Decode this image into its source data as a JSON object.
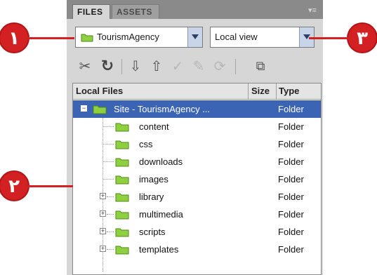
{
  "tabs": {
    "files": "FILES",
    "assets": "ASSETS"
  },
  "panel_menu_icon": "panel-menu-icon",
  "site_select": {
    "value": "TourismAgency"
  },
  "view_select": {
    "value": "Local view"
  },
  "toolbar_icons": [
    "connect-icon",
    "refresh-icon",
    "get-files-icon",
    "put-files-icon",
    "check-out-icon",
    "check-in-icon",
    "synchronize-icon",
    "expand-icon"
  ],
  "file_list": {
    "headers": {
      "name": "Local Files",
      "size": "Size",
      "type": "Type"
    },
    "root": {
      "name": "Site - TourismAgency ...",
      "type": "Folder"
    },
    "items": [
      {
        "name": "content",
        "type": "Folder",
        "expandable": false
      },
      {
        "name": "css",
        "type": "Folder",
        "expandable": false
      },
      {
        "name": "downloads",
        "type": "Folder",
        "expandable": false
      },
      {
        "name": "images",
        "type": "Folder",
        "expandable": false
      },
      {
        "name": "library",
        "type": "Folder",
        "expandable": true
      },
      {
        "name": "multimedia",
        "type": "Folder",
        "expandable": true
      },
      {
        "name": "scripts",
        "type": "Folder",
        "expandable": true
      },
      {
        "name": "templates",
        "type": "Folder",
        "expandable": true
      }
    ]
  },
  "callouts": {
    "one": "١",
    "two": "٢",
    "three": "٣"
  },
  "colors": {
    "callout": "#d32022",
    "selection": "#3c64b4",
    "folder": "#8fd040"
  }
}
